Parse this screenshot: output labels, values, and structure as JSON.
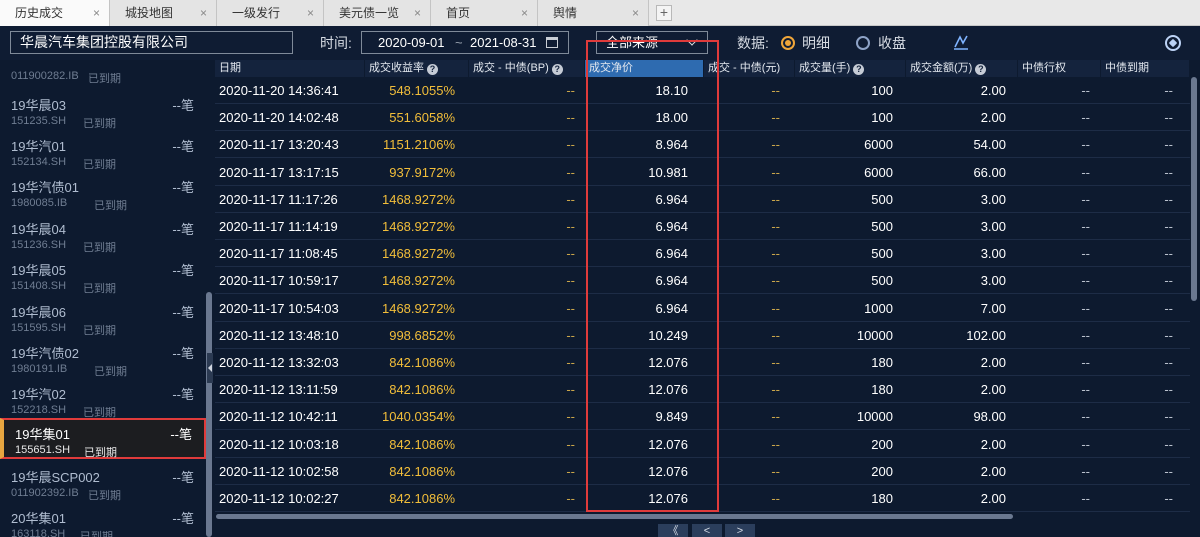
{
  "tabs": [
    {
      "label": "历史成交"
    },
    {
      "label": "城投地图"
    },
    {
      "label": "一级发行"
    },
    {
      "label": "美元债一览"
    },
    {
      "label": "首页"
    },
    {
      "label": "舆情"
    }
  ],
  "tab_close_glyph": "×",
  "tab_add_glyph": "+",
  "toolbar": {
    "company": "华晨汽车集团控股有限公司",
    "time_label": "时间:",
    "date_from": "2020-09-01",
    "date_sep": "~",
    "date_to": "2021-08-31",
    "source": "全部来源",
    "data_label": "数据:",
    "radio_detail": "明细",
    "radio_close": "收盘",
    "selected_radio": "明细"
  },
  "sidebar": {
    "items": [
      {
        "name": "",
        "code": "011900282.IB",
        "status": "已到期",
        "count": ""
      },
      {
        "name": "19华晨03",
        "code": "151235.SH",
        "status": "已到期",
        "count": "--笔"
      },
      {
        "name": "19华汽01",
        "code": "152134.SH",
        "status": "已到期",
        "count": "--笔"
      },
      {
        "name": "19华汽债01",
        "code": "1980085.IB",
        "status": "已到期",
        "count": "--笔"
      },
      {
        "name": "19华晨04",
        "code": "151236.SH",
        "status": "已到期",
        "count": "--笔"
      },
      {
        "name": "19华晨05",
        "code": "151408.SH",
        "status": "已到期",
        "count": "--笔"
      },
      {
        "name": "19华晨06",
        "code": "151595.SH",
        "status": "已到期",
        "count": "--笔"
      },
      {
        "name": "19华汽债02",
        "code": "1980191.IB",
        "status": "已到期",
        "count": "--笔"
      },
      {
        "name": "19华汽02",
        "code": "152218.SH",
        "status": "已到期",
        "count": "--笔"
      },
      {
        "name": "19华集01",
        "code": "155651.SH",
        "status": "已到期",
        "count": "--笔",
        "selected": true
      },
      {
        "name": "19华晨SCP002",
        "code": "011902392.IB",
        "status": "已到期",
        "count": "--笔"
      },
      {
        "name": "20华集01",
        "code": "163118.SH",
        "status": "已到期",
        "count": "--笔"
      }
    ]
  },
  "table": {
    "columns": [
      {
        "label": "日期",
        "help": false
      },
      {
        "label": "成交收益率",
        "help": true
      },
      {
        "label": "成交 - 中债(BP)",
        "help": true
      },
      {
        "label": "成交净价",
        "help": false
      },
      {
        "label": "成交 - 中债(元)",
        "help": false
      },
      {
        "label": "成交量(手)",
        "help": true
      },
      {
        "label": "成交金额(万)",
        "help": true
      },
      {
        "label": "中债行权",
        "help": false
      },
      {
        "label": "中债到期",
        "help": false
      }
    ],
    "help_glyph": "?",
    "highlighted_column": "成交净价",
    "rows": [
      [
        "2020-11-20 14:36:41",
        "548.1055%",
        "--",
        "18.10",
        "--",
        "100",
        "2.00",
        "--",
        "--"
      ],
      [
        "2020-11-20 14:02:48",
        "551.6058%",
        "--",
        "18.00",
        "--",
        "100",
        "2.00",
        "--",
        "--"
      ],
      [
        "2020-11-17 13:20:43",
        "1151.2106%",
        "--",
        "8.964",
        "--",
        "6000",
        "54.00",
        "--",
        "--"
      ],
      [
        "2020-11-17 13:17:15",
        "937.9172%",
        "--",
        "10.981",
        "--",
        "6000",
        "66.00",
        "--",
        "--"
      ],
      [
        "2020-11-17 11:17:26",
        "1468.9272%",
        "--",
        "6.964",
        "--",
        "500",
        "3.00",
        "--",
        "--"
      ],
      [
        "2020-11-17 11:14:19",
        "1468.9272%",
        "--",
        "6.964",
        "--",
        "500",
        "3.00",
        "--",
        "--"
      ],
      [
        "2020-11-17 11:08:45",
        "1468.9272%",
        "--",
        "6.964",
        "--",
        "500",
        "3.00",
        "--",
        "--"
      ],
      [
        "2020-11-17 10:59:17",
        "1468.9272%",
        "--",
        "6.964",
        "--",
        "500",
        "3.00",
        "--",
        "--"
      ],
      [
        "2020-11-17 10:54:03",
        "1468.9272%",
        "--",
        "6.964",
        "--",
        "1000",
        "7.00",
        "--",
        "--"
      ],
      [
        "2020-11-12 13:48:10",
        "998.6852%",
        "--",
        "10.249",
        "--",
        "10000",
        "102.00",
        "--",
        "--"
      ],
      [
        "2020-11-12 13:32:03",
        "842.1086%",
        "--",
        "12.076",
        "--",
        "180",
        "2.00",
        "--",
        "--"
      ],
      [
        "2020-11-12 13:11:59",
        "842.1086%",
        "--",
        "12.076",
        "--",
        "180",
        "2.00",
        "--",
        "--"
      ],
      [
        "2020-11-12 10:42:11",
        "1040.0354%",
        "--",
        "9.849",
        "--",
        "10000",
        "98.00",
        "--",
        "--"
      ],
      [
        "2020-11-12 10:03:18",
        "842.1086%",
        "--",
        "12.076",
        "--",
        "200",
        "2.00",
        "--",
        "--"
      ],
      [
        "2020-11-12 10:02:58",
        "842.1086%",
        "--",
        "12.076",
        "--",
        "200",
        "2.00",
        "--",
        "--"
      ],
      [
        "2020-11-12 10:02:27",
        "842.1086%",
        "--",
        "12.076",
        "--",
        "180",
        "2.00",
        "--",
        "--"
      ]
    ]
  },
  "pager": {
    "first": "《",
    "prev": "<",
    "next": ">"
  },
  "icons": {
    "calendar": "calendar-icon",
    "chart": "chart-icon",
    "refresh": "refresh-icon",
    "chevron": "chevron-down-icon"
  },
  "colors": {
    "background": "#0d1a2f",
    "accent": "#f0a63a",
    "yield_text": "#f2be3a",
    "header_highlight": "#2e6bb0",
    "annotation_red": "#e03b3b"
  }
}
